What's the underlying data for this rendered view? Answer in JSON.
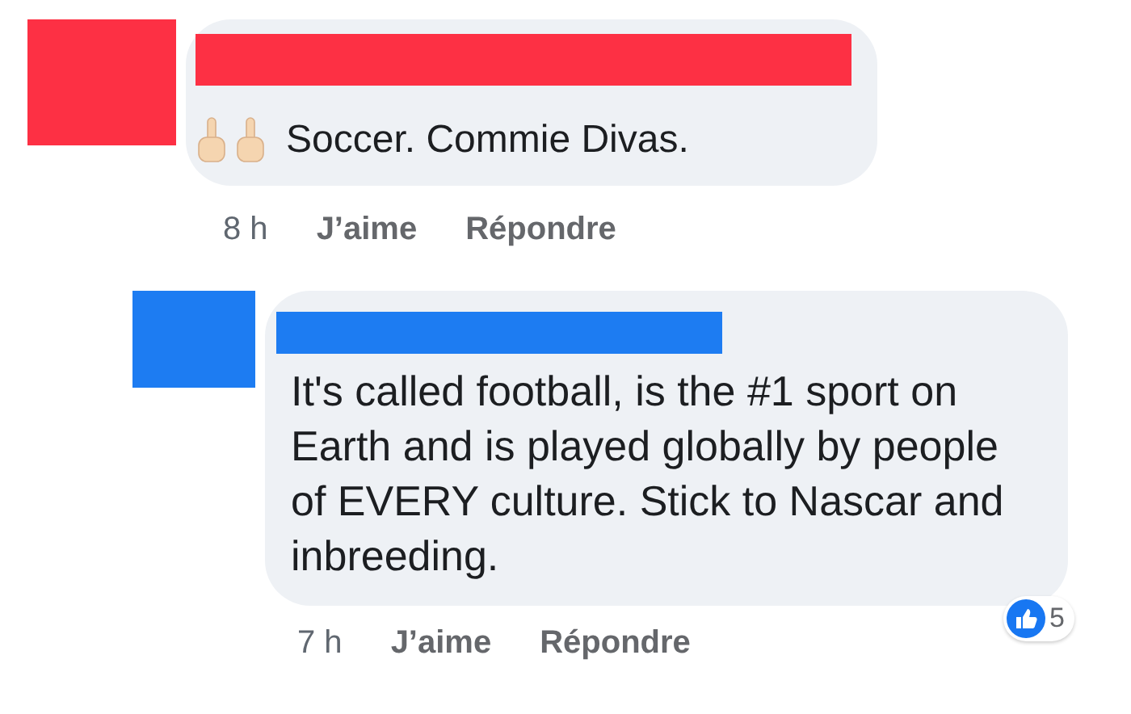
{
  "comments": [
    {
      "color": "#fd3044",
      "emojis": [
        {
          "kind": "middle_finger"
        },
        {
          "kind": "middle_finger"
        }
      ],
      "text": "Soccer. Commie Divas.",
      "time": "8 h",
      "actions": [
        "J’aime",
        "Répondre"
      ]
    },
    {
      "color": "#1d7cf2",
      "text": "It's called football, is the #1 sport on Earth and is played globally by people of EVERY culture. Stick to Nascar and inbreeding.",
      "time": "7 h",
      "actions": [
        "J’aime",
        "Répondre"
      ],
      "reactions": "5"
    }
  ]
}
